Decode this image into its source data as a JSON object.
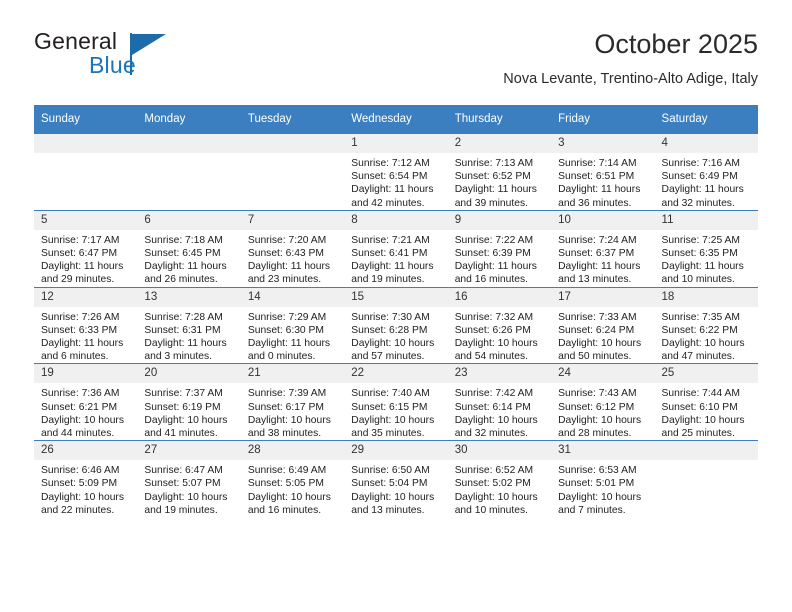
{
  "brand": {
    "name_part1": "General",
    "name_part2": "Blue",
    "logo_icon": "triangle-flag-icon"
  },
  "header": {
    "month_title": "October 2025",
    "location": "Nova Levante, Trentino-Alto Adige, Italy"
  },
  "colors": {
    "header_blue": "#3c7fc1",
    "brand_blue": "#1b75bb",
    "daynum_bg": "#f0f0f0"
  },
  "calendar": {
    "weekdays": [
      "Sunday",
      "Monday",
      "Tuesday",
      "Wednesday",
      "Thursday",
      "Friday",
      "Saturday"
    ],
    "weeks": [
      [
        {
          "day": "",
          "empty": true
        },
        {
          "day": "",
          "empty": true
        },
        {
          "day": "",
          "empty": true
        },
        {
          "day": "1",
          "sunrise": "Sunrise: 7:12 AM",
          "sunset": "Sunset: 6:54 PM",
          "daylight": "Daylight: 11 hours and 42 minutes."
        },
        {
          "day": "2",
          "sunrise": "Sunrise: 7:13 AM",
          "sunset": "Sunset: 6:52 PM",
          "daylight": "Daylight: 11 hours and 39 minutes."
        },
        {
          "day": "3",
          "sunrise": "Sunrise: 7:14 AM",
          "sunset": "Sunset: 6:51 PM",
          "daylight": "Daylight: 11 hours and 36 minutes."
        },
        {
          "day": "4",
          "sunrise": "Sunrise: 7:16 AM",
          "sunset": "Sunset: 6:49 PM",
          "daylight": "Daylight: 11 hours and 32 minutes."
        }
      ],
      [
        {
          "day": "5",
          "sunrise": "Sunrise: 7:17 AM",
          "sunset": "Sunset: 6:47 PM",
          "daylight": "Daylight: 11 hours and 29 minutes."
        },
        {
          "day": "6",
          "sunrise": "Sunrise: 7:18 AM",
          "sunset": "Sunset: 6:45 PM",
          "daylight": "Daylight: 11 hours and 26 minutes."
        },
        {
          "day": "7",
          "sunrise": "Sunrise: 7:20 AM",
          "sunset": "Sunset: 6:43 PM",
          "daylight": "Daylight: 11 hours and 23 minutes."
        },
        {
          "day": "8",
          "sunrise": "Sunrise: 7:21 AM",
          "sunset": "Sunset: 6:41 PM",
          "daylight": "Daylight: 11 hours and 19 minutes."
        },
        {
          "day": "9",
          "sunrise": "Sunrise: 7:22 AM",
          "sunset": "Sunset: 6:39 PM",
          "daylight": "Daylight: 11 hours and 16 minutes."
        },
        {
          "day": "10",
          "sunrise": "Sunrise: 7:24 AM",
          "sunset": "Sunset: 6:37 PM",
          "daylight": "Daylight: 11 hours and 13 minutes."
        },
        {
          "day": "11",
          "sunrise": "Sunrise: 7:25 AM",
          "sunset": "Sunset: 6:35 PM",
          "daylight": "Daylight: 11 hours and 10 minutes."
        }
      ],
      [
        {
          "day": "12",
          "sunrise": "Sunrise: 7:26 AM",
          "sunset": "Sunset: 6:33 PM",
          "daylight": "Daylight: 11 hours and 6 minutes."
        },
        {
          "day": "13",
          "sunrise": "Sunrise: 7:28 AM",
          "sunset": "Sunset: 6:31 PM",
          "daylight": "Daylight: 11 hours and 3 minutes."
        },
        {
          "day": "14",
          "sunrise": "Sunrise: 7:29 AM",
          "sunset": "Sunset: 6:30 PM",
          "daylight": "Daylight: 11 hours and 0 minutes."
        },
        {
          "day": "15",
          "sunrise": "Sunrise: 7:30 AM",
          "sunset": "Sunset: 6:28 PM",
          "daylight": "Daylight: 10 hours and 57 minutes."
        },
        {
          "day": "16",
          "sunrise": "Sunrise: 7:32 AM",
          "sunset": "Sunset: 6:26 PM",
          "daylight": "Daylight: 10 hours and 54 minutes."
        },
        {
          "day": "17",
          "sunrise": "Sunrise: 7:33 AM",
          "sunset": "Sunset: 6:24 PM",
          "daylight": "Daylight: 10 hours and 50 minutes."
        },
        {
          "day": "18",
          "sunrise": "Sunrise: 7:35 AM",
          "sunset": "Sunset: 6:22 PM",
          "daylight": "Daylight: 10 hours and 47 minutes."
        }
      ],
      [
        {
          "day": "19",
          "sunrise": "Sunrise: 7:36 AM",
          "sunset": "Sunset: 6:21 PM",
          "daylight": "Daylight: 10 hours and 44 minutes."
        },
        {
          "day": "20",
          "sunrise": "Sunrise: 7:37 AM",
          "sunset": "Sunset: 6:19 PM",
          "daylight": "Daylight: 10 hours and 41 minutes."
        },
        {
          "day": "21",
          "sunrise": "Sunrise: 7:39 AM",
          "sunset": "Sunset: 6:17 PM",
          "daylight": "Daylight: 10 hours and 38 minutes."
        },
        {
          "day": "22",
          "sunrise": "Sunrise: 7:40 AM",
          "sunset": "Sunset: 6:15 PM",
          "daylight": "Daylight: 10 hours and 35 minutes."
        },
        {
          "day": "23",
          "sunrise": "Sunrise: 7:42 AM",
          "sunset": "Sunset: 6:14 PM",
          "daylight": "Daylight: 10 hours and 32 minutes."
        },
        {
          "day": "24",
          "sunrise": "Sunrise: 7:43 AM",
          "sunset": "Sunset: 6:12 PM",
          "daylight": "Daylight: 10 hours and 28 minutes."
        },
        {
          "day": "25",
          "sunrise": "Sunrise: 7:44 AM",
          "sunset": "Sunset: 6:10 PM",
          "daylight": "Daylight: 10 hours and 25 minutes."
        }
      ],
      [
        {
          "day": "26",
          "sunrise": "Sunrise: 6:46 AM",
          "sunset": "Sunset: 5:09 PM",
          "daylight": "Daylight: 10 hours and 22 minutes."
        },
        {
          "day": "27",
          "sunrise": "Sunrise: 6:47 AM",
          "sunset": "Sunset: 5:07 PM",
          "daylight": "Daylight: 10 hours and 19 minutes."
        },
        {
          "day": "28",
          "sunrise": "Sunrise: 6:49 AM",
          "sunset": "Sunset: 5:05 PM",
          "daylight": "Daylight: 10 hours and 16 minutes."
        },
        {
          "day": "29",
          "sunrise": "Sunrise: 6:50 AM",
          "sunset": "Sunset: 5:04 PM",
          "daylight": "Daylight: 10 hours and 13 minutes."
        },
        {
          "day": "30",
          "sunrise": "Sunrise: 6:52 AM",
          "sunset": "Sunset: 5:02 PM",
          "daylight": "Daylight: 10 hours and 10 minutes."
        },
        {
          "day": "31",
          "sunrise": "Sunrise: 6:53 AM",
          "sunset": "Sunset: 5:01 PM",
          "daylight": "Daylight: 10 hours and 7 minutes."
        },
        {
          "day": "",
          "empty": true
        }
      ]
    ]
  }
}
